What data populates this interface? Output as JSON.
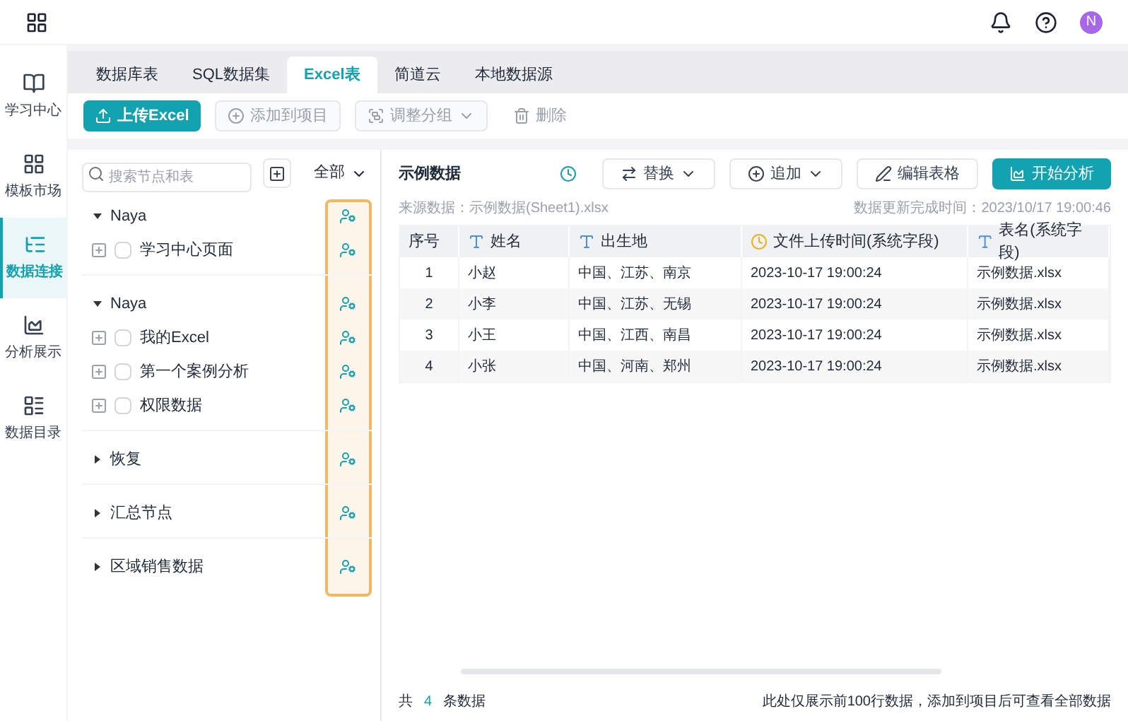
{
  "avatar": "N",
  "sidebar": {
    "items": [
      {
        "label": "学习中心",
        "selected": false
      },
      {
        "label": "模板市场",
        "selected": false
      },
      {
        "label": "数据连接",
        "selected": true
      },
      {
        "label": "分析展示",
        "selected": false
      },
      {
        "label": "数据目录",
        "selected": false
      }
    ]
  },
  "tabs": [
    {
      "label": "数据库表",
      "selected": false
    },
    {
      "label": "SQL数据集",
      "selected": false
    },
    {
      "label": "Excel表",
      "selected": true
    },
    {
      "label": "简道云",
      "selected": false
    },
    {
      "label": "本地数据源",
      "selected": false
    }
  ],
  "toolbar": [
    {
      "label": "上传Excel",
      "kind": "primary"
    },
    {
      "label": "添加到项目",
      "kind": "outlined-disabled"
    },
    {
      "label": "调整分组",
      "kind": "dropdown-disabled"
    },
    {
      "label": "删除",
      "kind": "text-disabled"
    }
  ],
  "tree_panel": {
    "search": {
      "placeholder": "搜索节点和表"
    },
    "filter": "全部",
    "groups": [
      {
        "label": "Naya",
        "expanded": true,
        "children": [
          {
            "label": "学习中心页面",
            "checked": false
          }
        ]
      },
      {
        "label": "Naya",
        "expanded": true,
        "children": [
          {
            "label": "我的Excel",
            "checked": false
          },
          {
            "label": "第一个案例分析",
            "checked": false
          },
          {
            "label": "权限数据",
            "checked": false
          }
        ]
      },
      {
        "label": "恢复",
        "expanded": false
      },
      {
        "label": "汇总节点",
        "expanded": false
      },
      {
        "label": "区域销售数据",
        "expanded": false
      }
    ]
  },
  "detail": {
    "title": "示例数据",
    "actions": [
      {
        "label": "替换",
        "kind": "dropdown"
      },
      {
        "label": "追加",
        "kind": "dropdown"
      },
      {
        "label": "编辑表格",
        "kind": "plain"
      },
      {
        "label": "开始分析",
        "kind": "primary"
      }
    ],
    "source": "来源数据：示例数据(Sheet1).xlsx",
    "updated": "数据更新完成时间：2023/10/17 19:00:46",
    "table": {
      "columns": [
        {
          "label": "序号",
          "kind": "index"
        },
        {
          "label": "姓名",
          "kind": "text"
        },
        {
          "label": "出生地",
          "kind": "text"
        },
        {
          "label": "文件上传时间(系统字段)",
          "kind": "time"
        },
        {
          "label": "表名(系统字段)",
          "kind": "text"
        }
      ],
      "rows": [
        [
          "1",
          "小赵",
          "中国、江苏、南京",
          "2023-10-17 19:00:24",
          "示例数据.xlsx"
        ],
        [
          "2",
          "小李",
          "中国、江苏、无锡",
          "2023-10-17 19:00:24",
          "示例数据.xlsx"
        ],
        [
          "3",
          "小王",
          "中国、江西、南昌",
          "2023-10-17 19:00:24",
          "示例数据.xlsx"
        ],
        [
          "4",
          "小张",
          "中国、河南、郑州",
          "2023-10-17 19:00:24",
          "示例数据.xlsx"
        ]
      ]
    },
    "footer": {
      "prefix": "共",
      "count": "4",
      "suffix": "条数据",
      "note": "此处仅展示前100行数据，添加到项目后可查看全部数据"
    }
  }
}
